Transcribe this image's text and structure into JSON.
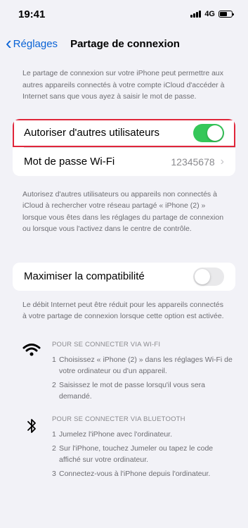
{
  "status_bar": {
    "time": "19:41",
    "network": "4G"
  },
  "nav": {
    "back_label": "Réglages",
    "title": "Partage de connexion"
  },
  "intro": "Le partage de connexion sur votre iPhone peut permettre aux autres appareils connectés à votre compte iCloud d'accéder à Internet sans que vous ayez à saisir le mot de passe.",
  "settings": {
    "allow_others_label": "Autoriser d'autres utilisateurs",
    "allow_others_on": true,
    "wifi_password_label": "Mot de passe Wi-Fi",
    "wifi_password_value": "12345678"
  },
  "allow_desc": "Autorisez d'autres utilisateurs ou appareils non connectés à iCloud à rechercher votre réseau partagé « iPhone (2) » lorsque vous êtes dans les réglages du partage de connexion ou lorsque vous l'activez dans le centre de contrôle.",
  "compat": {
    "label": "Maximiser la compatibilité",
    "on": false
  },
  "compat_desc": "Le débit Internet peut être réduit pour les appareils connectés à votre partage de connexion lorsque cette option est activée.",
  "wifi_section": {
    "icon": "wifi-icon",
    "header": "POUR SE CONNECTER VIA WI-FI",
    "steps": [
      {
        "num": "1",
        "text": "Choisissez « iPhone (2) » dans les réglages Wi-Fi de votre ordinateur ou d'un appareil."
      },
      {
        "num": "2",
        "text": "Saisissez le mot de passe lorsqu'il vous sera demandé."
      }
    ]
  },
  "bt_section": {
    "icon": "bluetooth-icon",
    "header": "POUR SE CONNECTER VIA BLUETOOTH",
    "steps": [
      {
        "num": "1",
        "text": "Jumelez l'iPhone avec l'ordinateur."
      },
      {
        "num": "2",
        "text": "Sur l'iPhone, touchez Jumeler ou tapez le code affiché sur votre ordinateur."
      },
      {
        "num": "3",
        "text": "Connectez-vous à l'iPhone depuis l'ordinateur."
      }
    ]
  },
  "colors": {
    "accent": "#0a63d6",
    "toggle_on": "#35c759",
    "highlight": "#e0263a"
  }
}
